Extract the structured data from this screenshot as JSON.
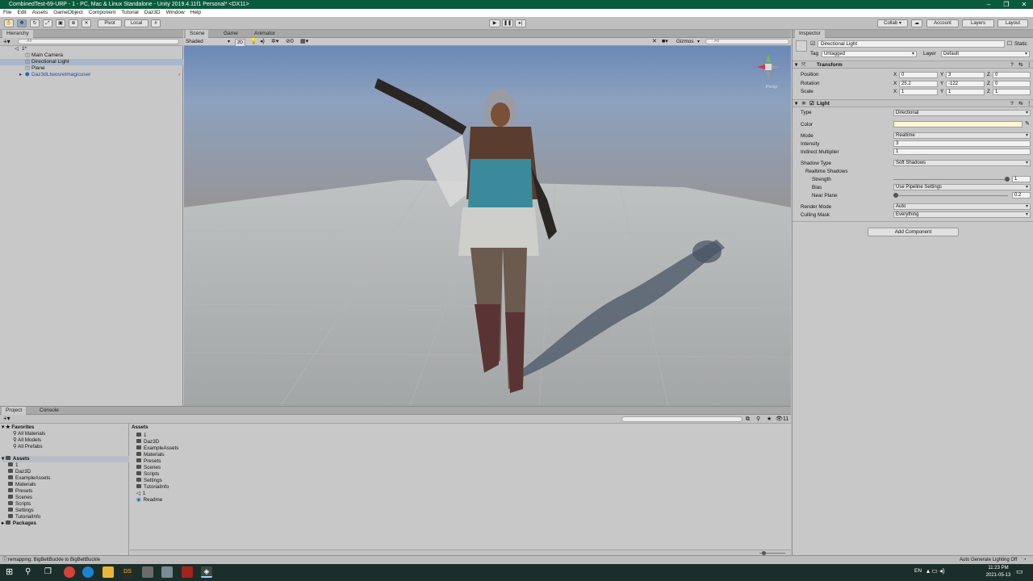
{
  "window": {
    "title": "CombinedTest-69-URP - 1 - PC, Mac & Linux Standalone - Unity 2019.4.11f1 Personal* <DX11>"
  },
  "menu": [
    "File",
    "Edit",
    "Assets",
    "GameObject",
    "Component",
    "Tutorial",
    "Daz3D",
    "Window",
    "Help"
  ],
  "toolbar": {
    "pivot": "Pivot",
    "local": "Local",
    "collab": "Collab ▾",
    "account": "Account",
    "layers": "Layers",
    "layout": "Layout"
  },
  "hierarchy": {
    "tab": "Hierarchy",
    "search_placeholder": "All",
    "scene": "1*",
    "items": [
      "Main Camera",
      "Directional Light",
      "Plane",
      "Daz3dLtwosretmagicuser"
    ]
  },
  "scene": {
    "tabs": [
      "Scene",
      "Game",
      "Animator"
    ],
    "shading": "Shaded",
    "mode2d": "2D",
    "gizmos": "Gizmos",
    "search_placeholder": "All",
    "persp": "Persp"
  },
  "inspector": {
    "tab": "Inspector",
    "object_name": "Directional Light",
    "static_label": "Static",
    "tag_label": "Tag",
    "tag_value": "Untagged",
    "layer_label": "Layer",
    "layer_value": "Default",
    "transform": {
      "title": "Transform",
      "position_label": "Position",
      "position": [
        "0",
        "3",
        "0"
      ],
      "rotation_label": "Rotation",
      "rotation": [
        "25.2",
        "-122",
        "0"
      ],
      "scale_label": "Scale",
      "scale": [
        "1",
        "1",
        "1"
      ]
    },
    "light": {
      "title": "Light",
      "type_label": "Type",
      "type_value": "Directional",
      "color_label": "Color",
      "color_value": "#FFF4D6",
      "mode_label": "Mode",
      "mode_value": "Realtime",
      "intensity_label": "Intensity",
      "intensity_value": "3",
      "indirect_label": "Indirect Multiplier",
      "indirect_value": "1",
      "shadow_type_label": "Shadow Type",
      "shadow_type_value": "Soft Shadows",
      "realtime_shadows_label": "Realtime Shadows",
      "strength_label": "Strength",
      "strength_value": "1",
      "bias_label": "Bias",
      "bias_value": "Use Pipeline Settings",
      "near_plane_label": "Near Plane",
      "near_plane_value": "0.2",
      "render_mode_label": "Render Mode",
      "render_mode_value": "Auto",
      "culling_label": "Culling Mask",
      "culling_value": "Everything"
    },
    "add_component": "Add Component"
  },
  "project": {
    "tabs": [
      "Project",
      "Console"
    ],
    "favorites_label": "Favorites",
    "favorites": [
      "All Materials",
      "All Models",
      "All Prefabs"
    ],
    "assets_label": "Assets",
    "assets_tree": [
      "1",
      "Daz3D",
      "ExampleAssets",
      "Materials",
      "Presets",
      "Scenes",
      "Scripts",
      "Settings",
      "TutorialInfo"
    ],
    "packages_label": "Packages",
    "breadcrumb": "Assets",
    "grid_items": [
      "1",
      "Daz3D",
      "ExampleAssets",
      "Materials",
      "Presets",
      "Scenes",
      "Scripts",
      "Settings",
      "TutorialInfo",
      "1",
      "Readme"
    ],
    "count": "11"
  },
  "status": {
    "message": "remapping: BigBeltBuckle to BigBeltBuckle",
    "right": "Auto Generate Lighting Off"
  },
  "taskbar": {
    "lang": "EN",
    "time": "11:23 PM",
    "date": "2021-05-13"
  },
  "colors": {
    "titlebar": "#0b5a3e",
    "sky_top": "#6a89b7",
    "ground": "#a3a6a6",
    "selection": "#a8b8cc"
  }
}
